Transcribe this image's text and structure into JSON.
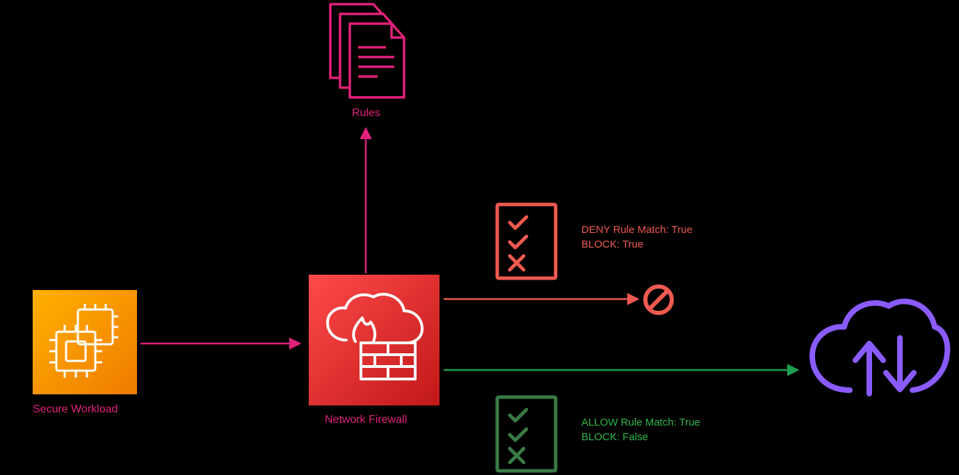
{
  "nodes": {
    "secure_workload": {
      "label": "Secure Workload"
    },
    "network_firewall": {
      "label": "Network Firewall"
    },
    "rules": {
      "label": "Rules"
    }
  },
  "deny": {
    "line1": "DENY Rule Match: True",
    "line2": "BLOCK: True"
  },
  "allow": {
    "line1": "ALLOW Rule Match: True",
    "line2": "BLOCK: False"
  },
  "colors": {
    "magenta": "#e2207a",
    "orange": "#f08c00",
    "red": "#d82c2c",
    "coral": "#f05a50",
    "green_line": "#1aa050",
    "green_dark": "#3a7a44",
    "green_text": "#2fb84a",
    "purple": "#8a5cff"
  }
}
